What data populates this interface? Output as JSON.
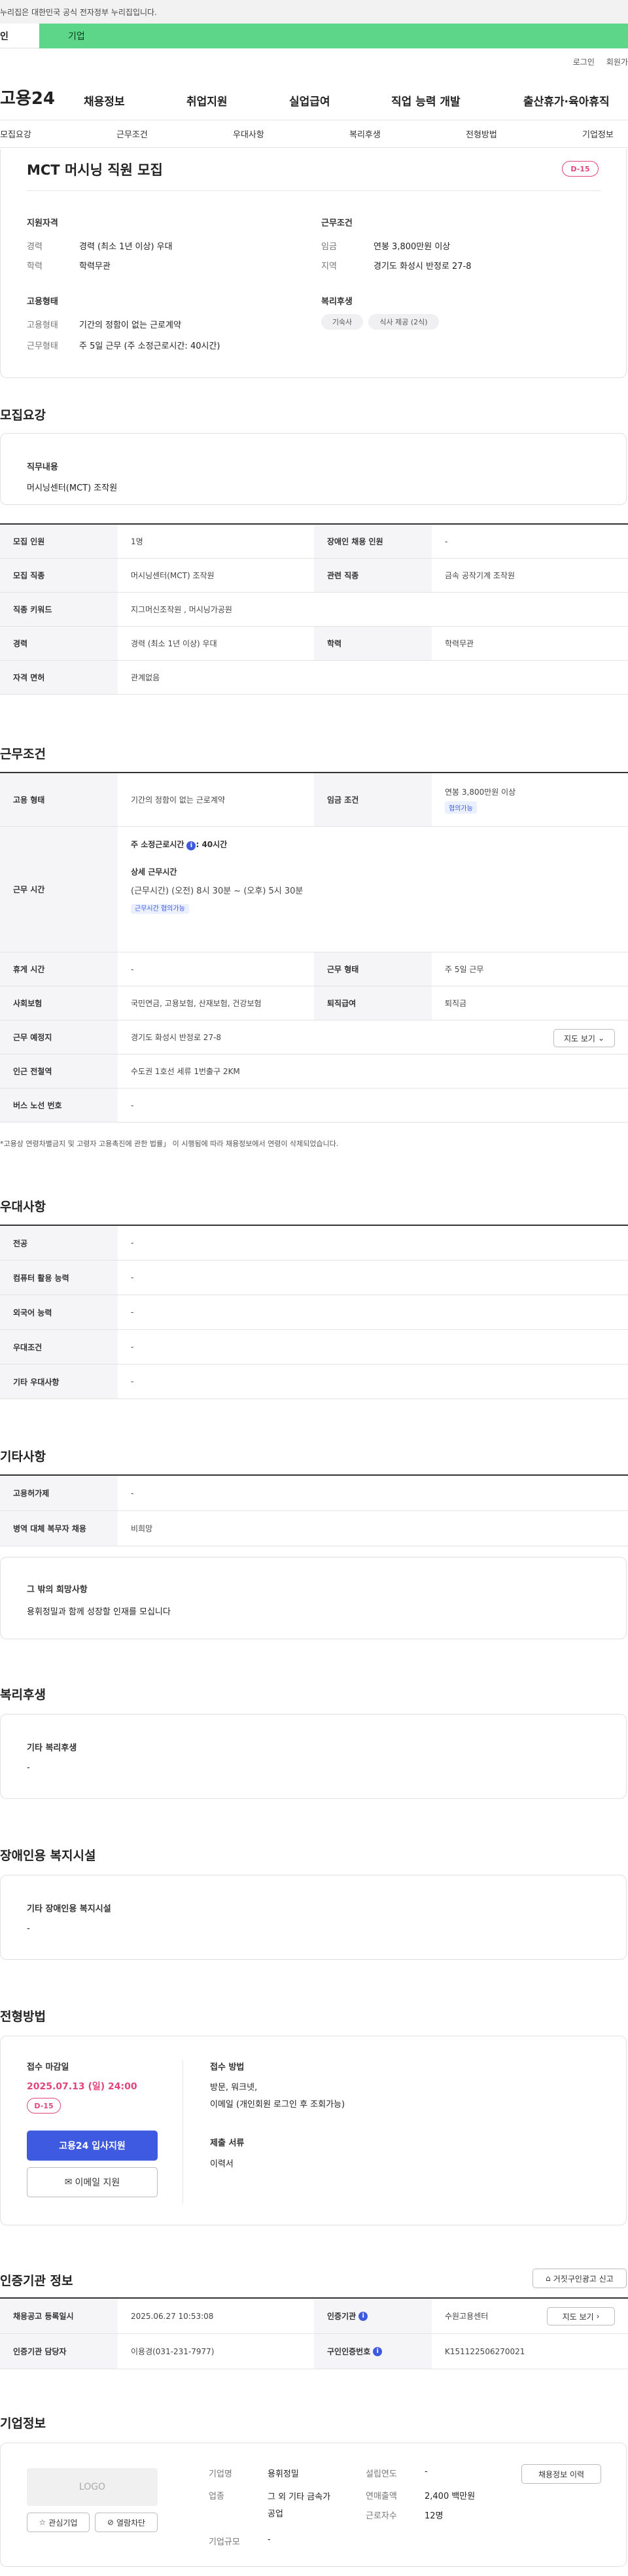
{
  "gov_notice": "누리집은 대한민국 공식 전자정부 누리집입니다.",
  "tabs": {
    "person": "인",
    "corp": "기업"
  },
  "util": {
    "login": "로그인",
    "signup": "회원가"
  },
  "logo": "고용24",
  "gnb": [
    "채용정보",
    "취업지원",
    "실업급여",
    "직업 능력 개발",
    "출산휴가·육아휴직"
  ],
  "subnav": [
    "모집요강",
    "근무조건",
    "우대사항",
    "복리후생",
    "전형방법",
    "기업정보"
  ],
  "summary": {
    "title": "MCT 머시닝 직원 모집",
    "dday": "D-15",
    "qual_title": "지원자격",
    "career_label": "경력",
    "career": "경력 (최소 1년 이상) 우대",
    "edu_label": "학력",
    "edu": "학력무관",
    "work_title": "근무조건",
    "wage_label": "임금",
    "wage": "연봉 3,800만원 이상",
    "area_label": "지역",
    "area": "경기도 화성시 반정로 27-8",
    "emp_title": "고용형태",
    "emptype_label": "고용형태",
    "emptype": "기간의 정함이 없는 근로계약",
    "worktype_label": "근무형태",
    "worktype": "주 5일 근무 (주 소정근로시간: 40시간)",
    "welfare_title": "복리후생",
    "welfare_chips": [
      "기숙사",
      "식사 제공 (2식)"
    ]
  },
  "recruit": {
    "title": "모집요강",
    "duty_label": "직무내용",
    "duty": "머시닝센터(MCT) 조작원",
    "rows": [
      {
        "l1": "모집 인원",
        "v1": "1명",
        "l2": "장애인 채용 인원",
        "v2": "-"
      },
      {
        "l1": "모집 직종",
        "v1": "머시닝센터(MCT) 조작원",
        "l2": "관련 직종",
        "v2": "금속 공작기계 조작원"
      },
      {
        "l1": "직종 키워드",
        "v1": "지그머신조작원 , 머시닝가공원"
      },
      {
        "l1": "경력",
        "v1": "경력 (최소 1년 이상) 우대",
        "l2": "학력",
        "v2": "학력무관"
      },
      {
        "l1": "자격 면허",
        "v1": "관계없음"
      }
    ]
  },
  "cond": {
    "title": "근무조건",
    "emp_label": "고용 형태",
    "emp": "기간의 정함이 없는 근로계약",
    "wage_label": "임금 조건",
    "wage": "연봉 3,800만원 이상",
    "wage_tag": "협의가능",
    "time_label": "근무 시간",
    "weekly": "주 소정근로시간",
    "weekly_val": ": 40시간",
    "detail_label": "상세 근무시간",
    "detail": "(근무시간) (오전) 8시 30분 ~ (오후) 5시 30분",
    "time_tag": "근무시간 협의가능",
    "rest_label": "휴게 시간",
    "rest": "-",
    "form_label": "근무 형태",
    "form": "주 5일 근무",
    "ins_label": "사회보험",
    "ins": "국민연금, 고용보험, 산재보험, 건강보험",
    "sev_label": "퇴직급여",
    "sev": "퇴직금",
    "place_label": "근무 예정지",
    "place": "경기도 화성시 반정로 27-8",
    "map_btn": "지도 보기",
    "station_label": "인근 전철역",
    "station": "수도권 1호선 세류 1번출구 2KM",
    "bus_label": "버스 노선 번호",
    "bus": "-",
    "note": "*고용상 연령차별금지 및 고령자 고용촉진에 관한 법률」 이 시행됨에 따라 채용정보에서 연령이 삭제되었습니다."
  },
  "pref": {
    "title": "우대사항",
    "rows": [
      {
        "l": "전공",
        "v": "-"
      },
      {
        "l": "컴퓨터 활용 능력",
        "v": "-"
      },
      {
        "l": "외국어 능력",
        "v": "-"
      },
      {
        "l": "우대조건",
        "v": "-"
      },
      {
        "l": "기타 우대사항",
        "v": "-"
      }
    ]
  },
  "etc": {
    "title": "기타사항",
    "rows": [
      {
        "l": "고용허가제",
        "v": "-"
      },
      {
        "l": "병역 대체 복무자 채용",
        "v": "비희망"
      }
    ],
    "wish_title": "그 밖의 희망사항",
    "wish": "용휘정밀과  함께 성장할 인재를 모십니다"
  },
  "welfare": {
    "title": "복리후생",
    "sub": "기타 복리후생",
    "val": "-"
  },
  "disab": {
    "title": "장애인용 복지시설",
    "sub": "기타 장애인용 복지시설",
    "val": "-"
  },
  "process": {
    "title": "전형방법",
    "deadline_label": "접수 마감일",
    "deadline": "2025.07.13 (일) 24:00",
    "dday": "D-15",
    "apply_btn": "고용24 입사지원",
    "email_btn": "이메일 지원",
    "method_label": "접수 방법",
    "method": "방문, 워크넷,\n이메일 (개인회원 로그인 후 조회가능)",
    "docs_label": "제출 서류",
    "docs": "이력서"
  },
  "cert": {
    "title": "인증기관 정보",
    "report_btn": "거짓구인광고 신고",
    "r1": {
      "l1": "채용공고 등록일시",
      "v1": "2025.06.27 10:53:08",
      "l2": "인증기관",
      "v2": "수원고용센터",
      "btn": "지도 보기"
    },
    "r2": {
      "l1": "인증기관 담당자",
      "v1": "이용경(031-231-7977)",
      "l2": "구인인증번호",
      "v2": "K151122506270021"
    }
  },
  "company": {
    "title": "기업정보",
    "logo": "LOGO",
    "fav_btn": "관심기업",
    "block_btn": "열람차단",
    "name_label": "기업명",
    "name": "용휘정밀",
    "industry_label": "업종",
    "industry": "그 외 기타 금속가\n공업",
    "size_label": "기업규모",
    "size": "-",
    "year_label": "설립연도",
    "year": "-",
    "sales_label": "연매출액",
    "sales": "2,400 백만원",
    "emp_label": "근로자수",
    "emp": "12명",
    "history_btn": "채용정보 이력"
  }
}
